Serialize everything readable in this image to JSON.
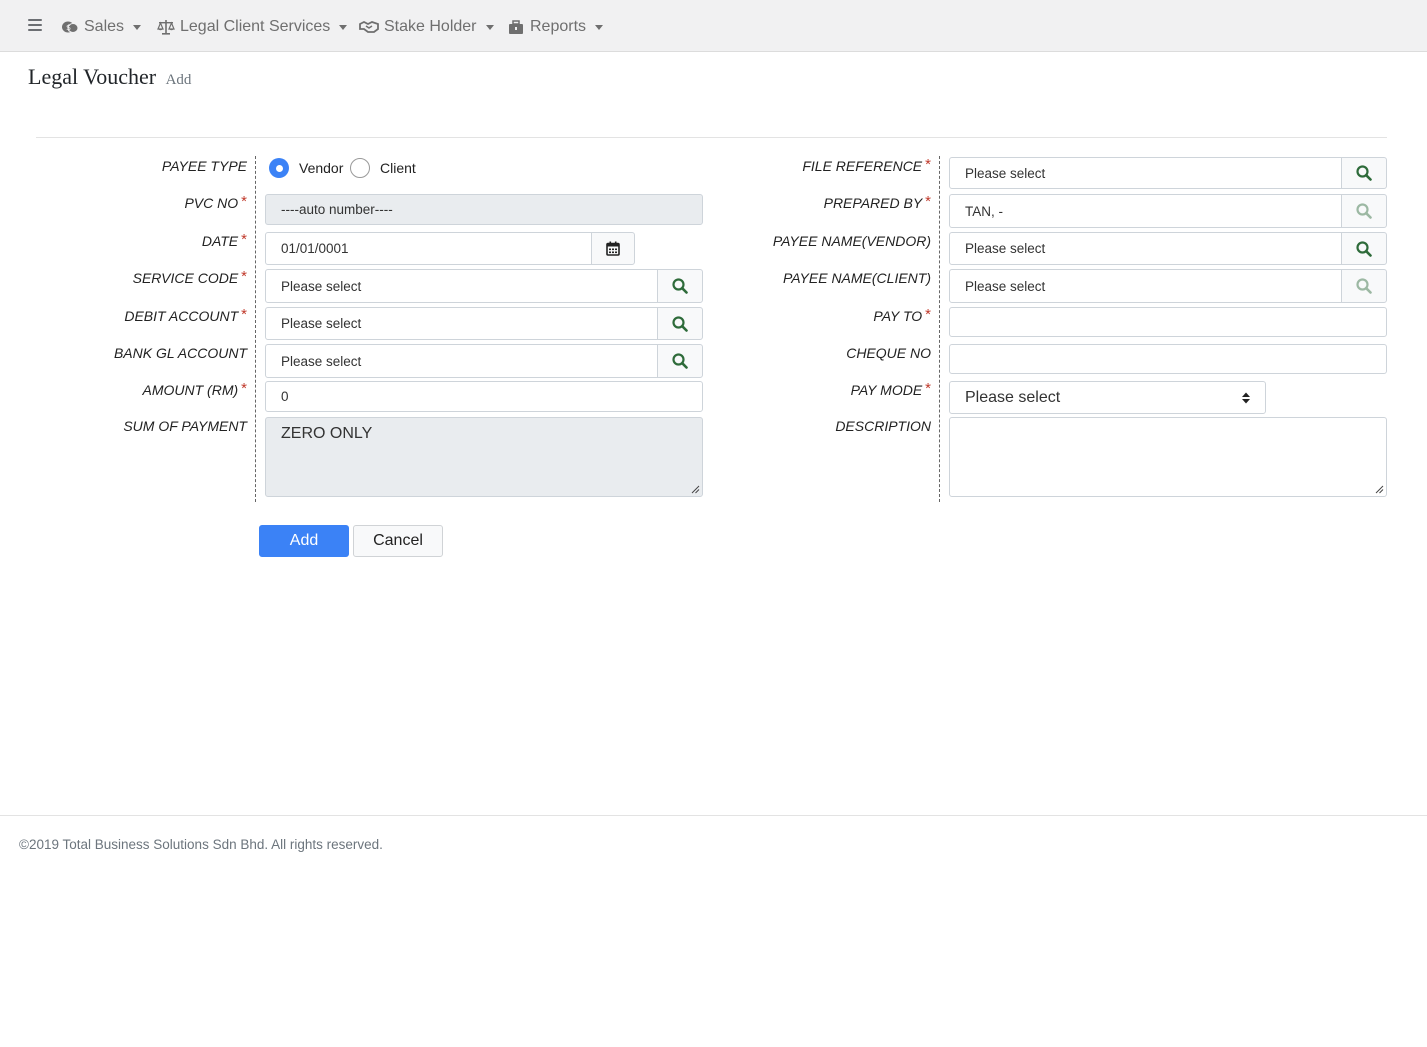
{
  "nav": {
    "items": [
      {
        "label": "Sales",
        "icon": "coins-icon"
      },
      {
        "label": "Legal Client Services",
        "icon": "balance-scale-icon"
      },
      {
        "label": "Stake Holder",
        "icon": "handshake-icon"
      },
      {
        "label": "Reports",
        "icon": "briefcase-icon"
      }
    ]
  },
  "page": {
    "title": "Legal Voucher",
    "subtitle": "Add"
  },
  "form": {
    "payee_type": {
      "label": "PAYEE TYPE",
      "options": [
        "Vendor",
        "Client"
      ],
      "selected": "Vendor"
    },
    "pvc_no": {
      "label": "PVC NO",
      "value": "----auto number----"
    },
    "date": {
      "label": "DATE",
      "value": "01/01/0001"
    },
    "service_code": {
      "label": "SERVICE CODE",
      "placeholder": "Please select"
    },
    "debit_account": {
      "label": "DEBIT ACCOUNT",
      "placeholder": "Please select"
    },
    "bank_gl_account": {
      "label": "BANK GL ACCOUNT",
      "placeholder": "Please select"
    },
    "amount": {
      "label": "AMOUNT (RM)",
      "value": "0"
    },
    "sum_of_payment": {
      "label": "SUM OF PAYMENT",
      "value": "ZERO ONLY"
    },
    "file_reference": {
      "label": "FILE REFERENCE",
      "placeholder": "Please select"
    },
    "prepared_by": {
      "label": "PREPARED BY",
      "value": "TAN, -"
    },
    "payee_name_vendor": {
      "label": "PAYEE NAME(VENDOR)",
      "placeholder": "Please select"
    },
    "payee_name_client": {
      "label": "PAYEE NAME(CLIENT)",
      "placeholder": "Please select"
    },
    "pay_to": {
      "label": "PAY TO",
      "value": ""
    },
    "cheque_no": {
      "label": "CHEQUE NO",
      "value": ""
    },
    "pay_mode": {
      "label": "PAY MODE",
      "selected": "Please select"
    },
    "description": {
      "label": "DESCRIPTION",
      "value": ""
    },
    "required_mark": "*"
  },
  "buttons": {
    "add": "Add",
    "cancel": "Cancel"
  },
  "footer": {
    "text": "©2019 Total Business Solutions Sdn Bhd. All rights reserved."
  },
  "colors": {
    "primary": "#3b82f6",
    "search_icon": "#2e6b3a",
    "required": "#c0392b"
  }
}
